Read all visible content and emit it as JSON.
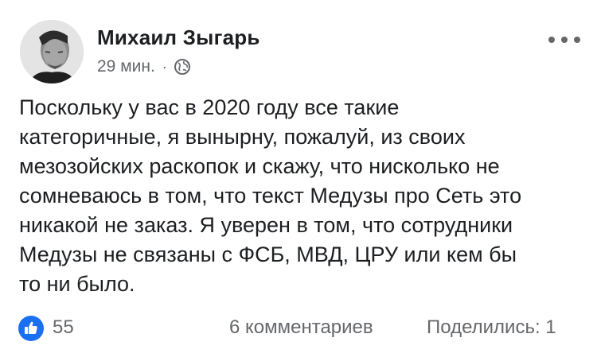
{
  "post": {
    "author": {
      "name": "Михаил Зыгарь",
      "avatar": "avatar-photo"
    },
    "timestamp": "29 мин.",
    "separator": "·",
    "audience_icon": "globe-icon",
    "more_icon": "more-options-icon",
    "text": "Поскольку у вас в 2020 году все такие\nкатегоричные, я вынырну, пожалуй, из своих\nмезозойских раскопок и скажу, что нисколько не\nсомневаюсь в том, что текст Медузы про Сеть это\nникакой не заказ. Я уверен в том, что сотрудники\nМедузы не связаны с ФСБ, МВД, ЦРУ или кем бы\nто ни было."
  },
  "footer": {
    "reaction_icon": "thumbs-up-icon",
    "reaction_count": "55",
    "comments": "6 комментариев",
    "shares": "Поделились: 1"
  },
  "colors": {
    "text": "#1c1e21",
    "secondary": "#65676b",
    "like_blue": "#1b6ff2"
  }
}
